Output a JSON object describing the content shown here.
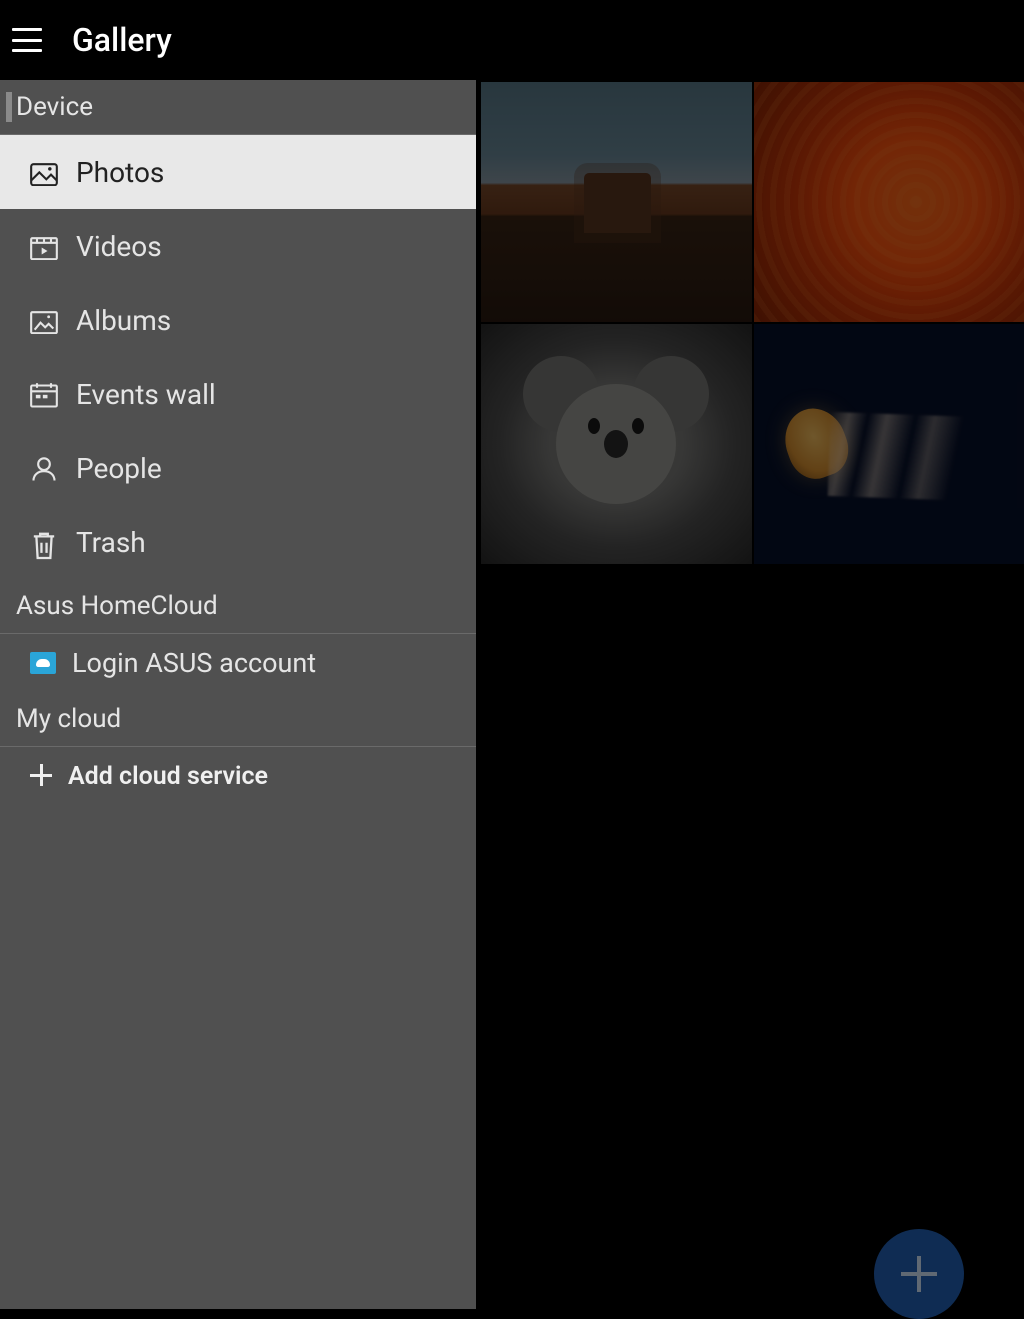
{
  "header": {
    "title": "Gallery"
  },
  "drawer": {
    "sections": {
      "device": {
        "label": "Device"
      },
      "homecloud": {
        "label": "Asus HomeCloud"
      },
      "mycloud": {
        "label": "My cloud"
      }
    },
    "nav": {
      "photos": "Photos",
      "videos": "Videos",
      "albums": "Albums",
      "events_wall": "Events wall",
      "people": "People",
      "trash": "Trash"
    },
    "active": "photos",
    "homecloud_login": "Login ASUS account",
    "add_cloud": "Add cloud service"
  },
  "grid": {
    "thumbs": [
      "landscape-mesa",
      "orange-flower",
      "koala",
      "jellyfish"
    ]
  }
}
